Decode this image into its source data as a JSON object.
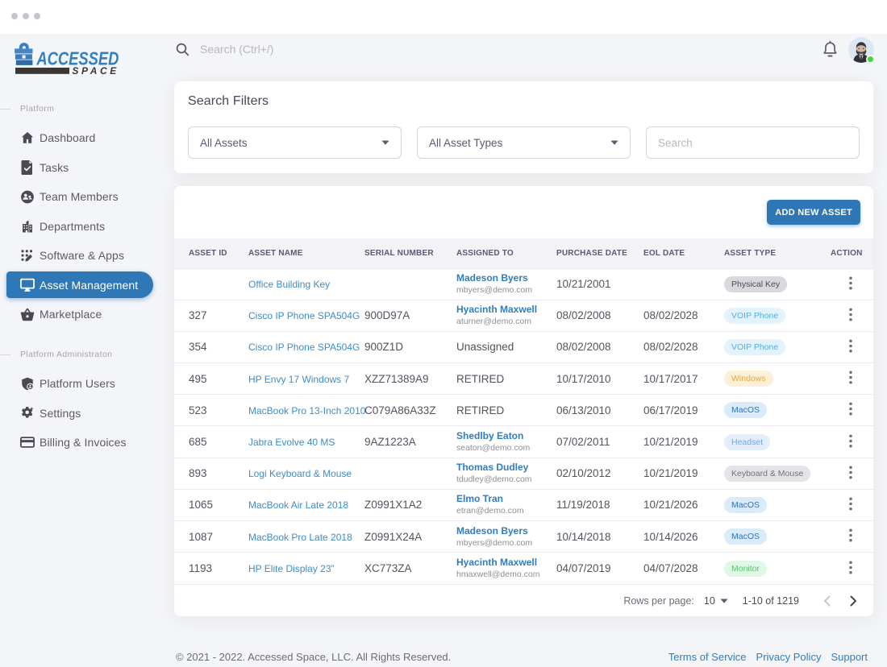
{
  "brand": {
    "name_line1": "ACCESSED",
    "name_line2": "SPACE"
  },
  "topbar": {
    "search_placeholder": "Search (Ctrl+/)"
  },
  "sidebar": {
    "sections": [
      {
        "label": "Platform",
        "items": [
          {
            "label": "Dashboard",
            "icon": "home-icon",
            "active": false
          },
          {
            "label": "Tasks",
            "icon": "task-icon",
            "active": false
          },
          {
            "label": "Team Members",
            "icon": "team-icon",
            "active": false
          },
          {
            "label": "Departments",
            "icon": "building-icon",
            "active": false
          },
          {
            "label": "Software & Apps",
            "icon": "apps-icon",
            "active": false
          },
          {
            "label": "Asset Management",
            "icon": "monitor-icon",
            "active": true
          },
          {
            "label": "Marketplace",
            "icon": "basket-icon",
            "active": false
          }
        ]
      },
      {
        "label": "Platform Administraton",
        "items": [
          {
            "label": "Platform Users",
            "icon": "shield-user-icon",
            "active": false
          },
          {
            "label": "Settings",
            "icon": "gear-icon",
            "active": false
          },
          {
            "label": "Billing & Invoices",
            "icon": "credit-card-icon",
            "active": false
          }
        ]
      }
    ]
  },
  "filters": {
    "title": "Search Filters",
    "asset_select_value": "All Assets",
    "type_select_value": "All Asset Types",
    "search_placeholder": "Search"
  },
  "table": {
    "add_button_label": "ADD NEW ASSET",
    "columns": [
      "Asset ID",
      "Asset Name",
      "Serial Number",
      "Assigned To",
      "Purchase Date",
      "EOL Date",
      "Asset Type",
      "Action"
    ],
    "rows": [
      {
        "id": "",
        "name": "Office Building Key",
        "serial": "",
        "assigned": "Madeson Byers",
        "email": "mbyers@demo.com",
        "assigned_link": true,
        "purchase": "10/21/2001",
        "eol": "",
        "type": "Physical Key",
        "type_color": "gray"
      },
      {
        "id": "327",
        "name": "Cisco IP Phone SPA504G",
        "serial": "900D97A",
        "assigned": "Hyacinth Maxwell",
        "email": "aturner@demo.com",
        "assigned_link": true,
        "purchase": "08/02/2008",
        "eol": "08/02/2028",
        "type": "VOIP Phone",
        "type_color": "sky"
      },
      {
        "id": "354",
        "name": "Cisco IP Phone SPA504G",
        "serial": "900Z1D",
        "assigned": "Unassigned",
        "email": "",
        "assigned_link": false,
        "purchase": "08/02/2008",
        "eol": "08/02/2028",
        "type": "VOIP Phone",
        "type_color": "sky"
      },
      {
        "id": "495",
        "name": "HP Envy 17 Windows 7",
        "serial": "XZZ71389A9",
        "assigned": "RETIRED",
        "email": "",
        "assigned_link": false,
        "purchase": "10/17/2010",
        "eol": "10/17/2017",
        "type": "Windows",
        "type_color": "amber"
      },
      {
        "id": "523",
        "name": "MacBook Pro 13-Inch 2010",
        "serial": "C079A86A33Z",
        "assigned": "RETIRED",
        "email": "",
        "assigned_link": false,
        "purchase": "06/13/2010",
        "eol": "06/17/2019",
        "type": "MacOS",
        "type_color": "blue"
      },
      {
        "id": "685",
        "name": "Jabra Evolve 40 MS",
        "serial": "9AZ1223A",
        "assigned": "Shedlby Eaton",
        "email": "seaton@demo.com",
        "assigned_link": true,
        "purchase": "07/02/2011",
        "eol": "10/21/2019",
        "type": "Headset",
        "type_color": "lightblue"
      },
      {
        "id": "893",
        "name": "Logi Keyboard & Mouse",
        "serial": "",
        "assigned": "Thomas Dudley",
        "email": "tdudley@demo.com",
        "assigned_link": true,
        "purchase": "02/10/2012",
        "eol": "10/21/2019",
        "type": "Keyboard & Mouse",
        "type_color": "gray2"
      },
      {
        "id": "1065",
        "name": "MacBook Air Late 2018",
        "serial": "Z0991X1A2",
        "assigned": "Elmo Tran",
        "email": "etran@demo.com",
        "assigned_link": true,
        "purchase": "11/19/2018",
        "eol": "10/21/2026",
        "type": "MacOS",
        "type_color": "blue"
      },
      {
        "id": "1087",
        "name": "MacBook Pro Late 2018",
        "serial": "Z0991X24A",
        "assigned": "Madeson Byers",
        "email": "mbyers@demo.com",
        "assigned_link": true,
        "purchase": "10/14/2018",
        "eol": "10/14/2026",
        "type": "MacOS",
        "type_color": "blue"
      },
      {
        "id": "1193",
        "name": "HP Elite Display 23”",
        "serial": "XC773ZA",
        "assigned": "Hyacinth Maxwell",
        "email": "hmaxwell@demo.com",
        "assigned_link": true,
        "purchase": "04/07/2019",
        "eol": "04/07/2028",
        "type": "Monitor",
        "type_color": "green"
      }
    ],
    "badge_palette": {
      "gray": {
        "bg": "#d9d8dd",
        "fg": "#4e4c55"
      },
      "sky": {
        "bg": "#e2f3fd",
        "fg": "#55aee2"
      },
      "amber": {
        "bg": "#fdf0d8",
        "fg": "#e8a93f"
      },
      "blue": {
        "bg": "#dcebfa",
        "fg": "#2e74ba"
      },
      "lightblue": {
        "bg": "#e4eefb",
        "fg": "#6fa7e2"
      },
      "gray2": {
        "bg": "#e4e4e8",
        "fg": "#747279"
      },
      "green": {
        "bg": "#e2f8e6",
        "fg": "#58c269"
      }
    },
    "pagination": {
      "rows_per_page_label": "Rows per page:",
      "rows_per_page_value": "10",
      "range": "1-10 of 1219"
    }
  },
  "footer": {
    "copyright": "© 2021 - 2022. Accessed Space, LLC. All Rights Reserved.",
    "links": [
      "Terms of Service",
      "Privacy Policy",
      "Support"
    ]
  },
  "colors": {
    "primary_blue": "#2e76b5",
    "active_nav_blue": "#2e78b7",
    "link_blue": "#3f8cc9",
    "status_online_green": "#45d63d"
  }
}
